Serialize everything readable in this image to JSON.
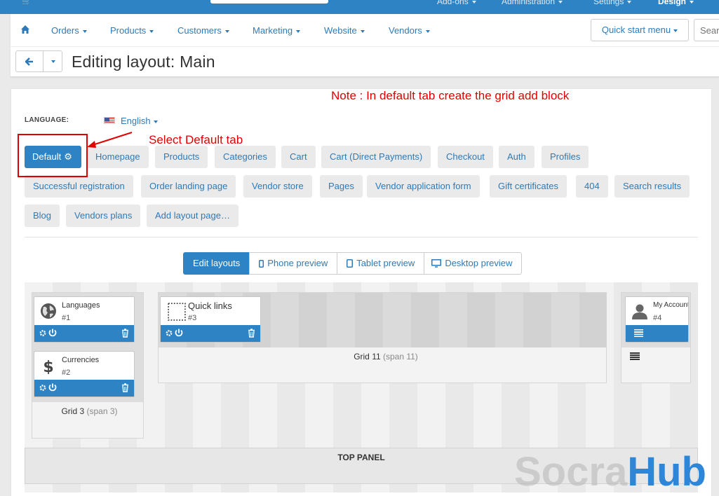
{
  "topbar": {
    "items": [
      "Add-ons",
      "Administration",
      "Settings",
      "Design"
    ]
  },
  "menu": {
    "items": [
      "Orders",
      "Products",
      "Customers",
      "Marketing",
      "Website",
      "Vendors"
    ],
    "quick_start": "Quick start menu",
    "search_placeholder": "Search"
  },
  "page": {
    "title": "Editing layout: Main"
  },
  "annotations": {
    "note": "Note : In default tab create the grid add block",
    "select_default": "Select Default tab"
  },
  "language": {
    "label": "LANGUAGE:",
    "value": "English"
  },
  "tabs": [
    {
      "label": "Default",
      "active": true
    },
    {
      "label": "Homepage"
    },
    {
      "label": "Products"
    },
    {
      "label": "Categories"
    },
    {
      "label": "Cart"
    },
    {
      "label": "Cart (Direct Payments)"
    },
    {
      "label": "Checkout"
    },
    {
      "label": "Auth"
    },
    {
      "label": "Profiles"
    },
    {
      "label": "Successful registration"
    },
    {
      "label": "Order landing page"
    },
    {
      "label": "Vendor store"
    },
    {
      "label": "Pages"
    },
    {
      "label": "Vendor application form"
    },
    {
      "label": "Gift certificates"
    },
    {
      "label": "404"
    },
    {
      "label": "Search results"
    },
    {
      "label": "Blog"
    },
    {
      "label": "Vendors plans"
    },
    {
      "label": "Add layout page…"
    }
  ],
  "view_modes": [
    "Edit layouts",
    "Phone preview",
    "Tablet preview",
    "Desktop preview"
  ],
  "grids": [
    {
      "name": "Grid 3",
      "span": "(span 3)"
    },
    {
      "name": "Grid 11",
      "span": "(span 11)"
    }
  ],
  "blocks": [
    {
      "name": "Languages",
      "num": "#1",
      "icon": "globe-icon"
    },
    {
      "name": "Currencies",
      "num": "#2",
      "icon": "dollar-icon"
    },
    {
      "name": "Quick links",
      "num": "#3",
      "icon": "dotted-square-icon"
    },
    {
      "name": "My Account",
      "num": "#4",
      "icon": "user-icon"
    }
  ],
  "top_panel": "TOP PANEL",
  "watermark": {
    "part1": "Socra",
    "part2": "Hub"
  },
  "colors": {
    "primary": "#2e83c4",
    "annotation": "#e00000",
    "link": "#2e7ab8"
  }
}
